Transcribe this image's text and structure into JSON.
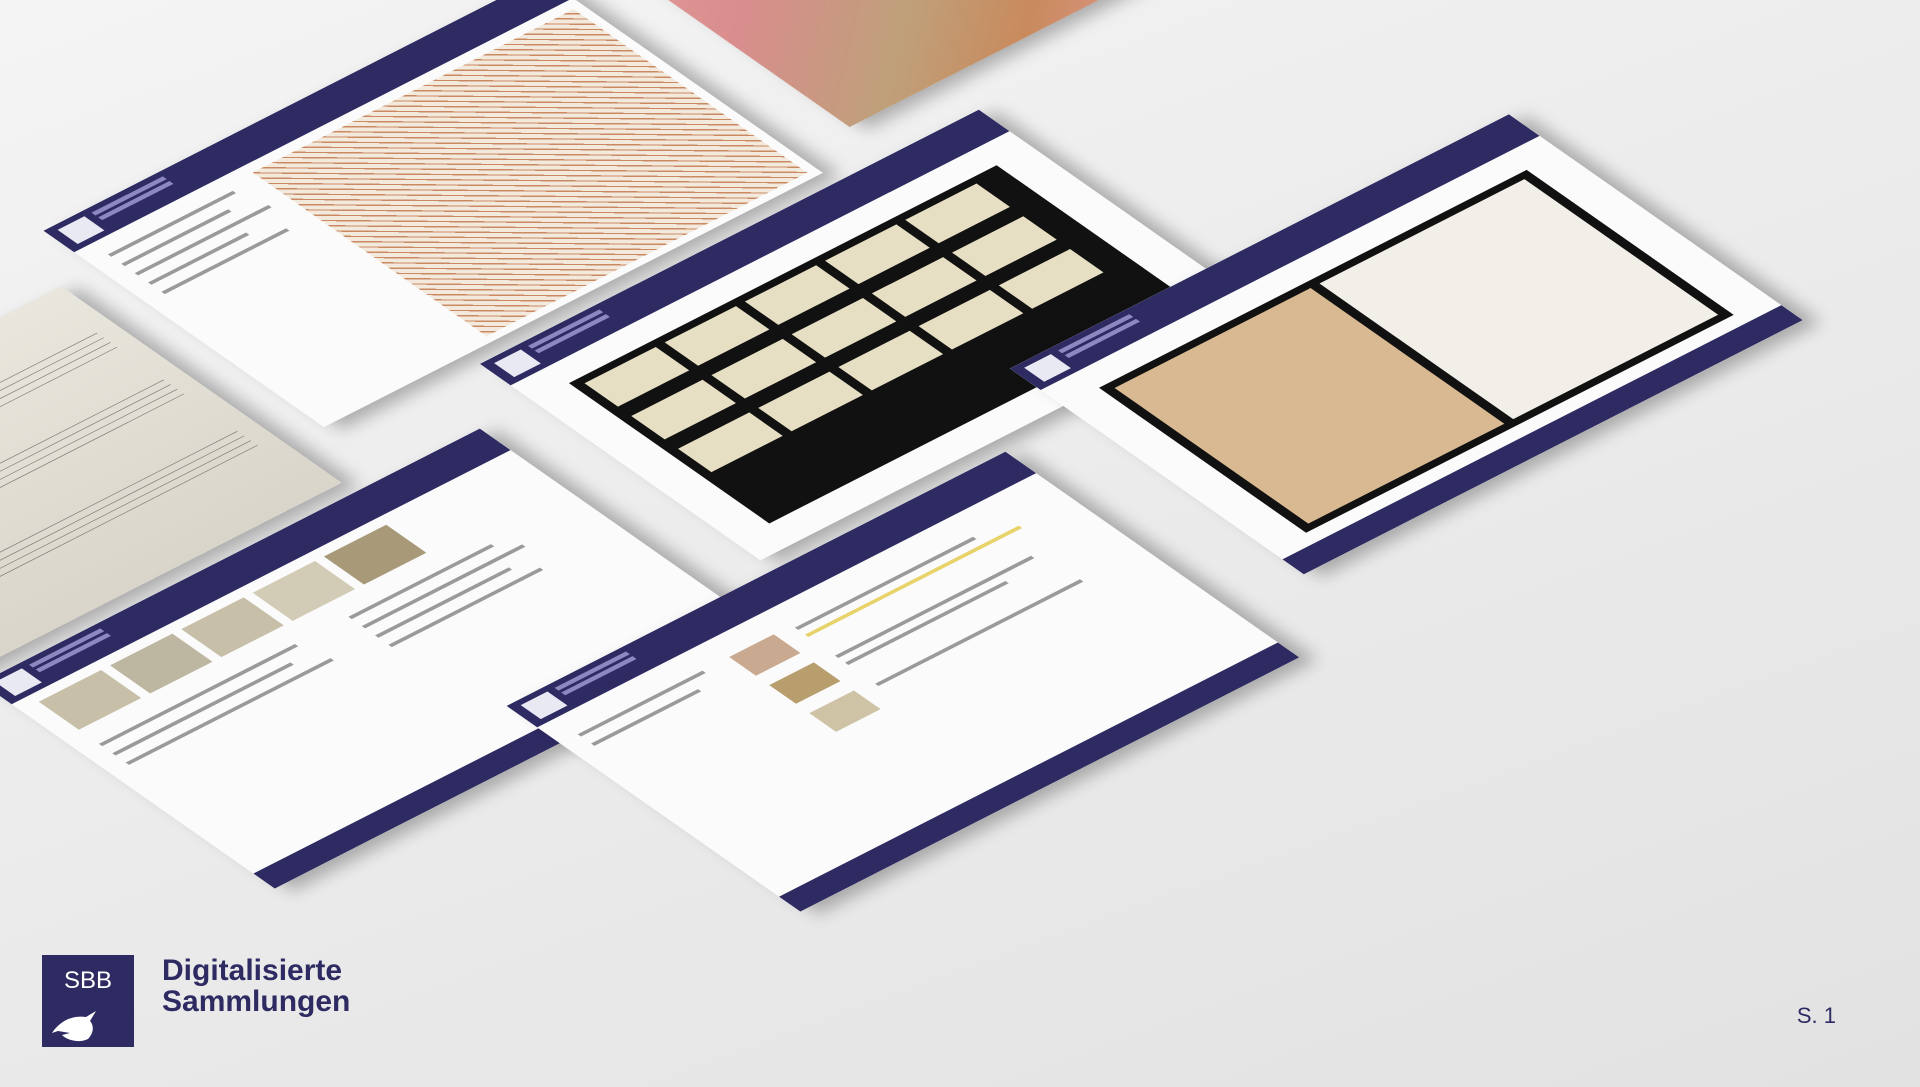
{
  "brand": {
    "badge": "SBB",
    "title_line1": "Digitalisierte",
    "title_line2": "Sammlungen",
    "color": "#2e2a62"
  },
  "slide": {
    "page_label": "S. 1"
  },
  "decorative_icons": [
    "eagle-icon"
  ]
}
